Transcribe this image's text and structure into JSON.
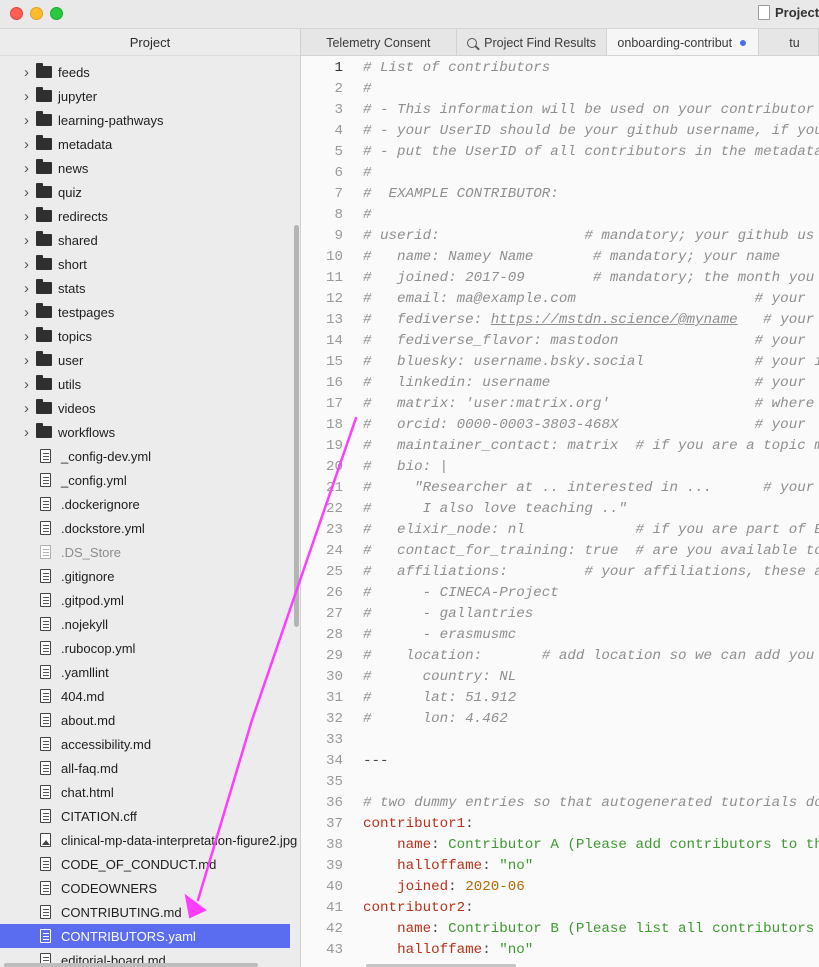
{
  "window": {
    "title": "Project"
  },
  "sidebar": {
    "header": "Project",
    "items": [
      {
        "type": "folder",
        "label": "feeds"
      },
      {
        "type": "folder",
        "label": "jupyter"
      },
      {
        "type": "folder",
        "label": "learning-pathways"
      },
      {
        "type": "folder",
        "label": "metadata"
      },
      {
        "type": "folder",
        "label": "news"
      },
      {
        "type": "folder",
        "label": "quiz"
      },
      {
        "type": "folder",
        "label": "redirects"
      },
      {
        "type": "folder",
        "label": "shared"
      },
      {
        "type": "folder",
        "label": "short"
      },
      {
        "type": "folder",
        "label": "stats"
      },
      {
        "type": "folder",
        "label": "testpages"
      },
      {
        "type": "folder",
        "label": "topics"
      },
      {
        "type": "folder",
        "label": "user"
      },
      {
        "type": "folder",
        "label": "utils"
      },
      {
        "type": "folder",
        "label": "videos"
      },
      {
        "type": "folder",
        "label": "workflows"
      },
      {
        "type": "file",
        "label": "_config-dev.yml"
      },
      {
        "type": "file",
        "label": "_config.yml"
      },
      {
        "type": "file",
        "label": ".dockerignore"
      },
      {
        "type": "file",
        "label": ".dockstore.yml"
      },
      {
        "type": "file",
        "label": ".DS_Store",
        "dim": true
      },
      {
        "type": "file",
        "label": ".gitignore"
      },
      {
        "type": "file",
        "label": ".gitpod.yml"
      },
      {
        "type": "file",
        "label": ".nojekyll"
      },
      {
        "type": "file",
        "label": ".rubocop.yml"
      },
      {
        "type": "file",
        "label": ".yamllint"
      },
      {
        "type": "file",
        "label": "404.md"
      },
      {
        "type": "file",
        "label": "about.md"
      },
      {
        "type": "file",
        "label": "accessibility.md"
      },
      {
        "type": "file",
        "label": "all-faq.md"
      },
      {
        "type": "file",
        "label": "chat.html"
      },
      {
        "type": "file",
        "label": "CITATION.cff"
      },
      {
        "type": "image",
        "label": "clinical-mp-data-interpretation-figure2.jpg"
      },
      {
        "type": "file",
        "label": "CODE_OF_CONDUCT.md"
      },
      {
        "type": "file",
        "label": "CODEOWNERS"
      },
      {
        "type": "file",
        "label": "CONTRIBUTING.md"
      },
      {
        "type": "file",
        "label": "CONTRIBUTORS.yaml",
        "selected": true
      },
      {
        "type": "file",
        "label": "editorial-board.md"
      }
    ]
  },
  "tabs": [
    {
      "label": "Telemetry Consent"
    },
    {
      "label": "Project Find Results",
      "icon": "search-icon"
    },
    {
      "label": "onboarding-contribut",
      "modified": true,
      "active": true
    },
    {
      "label": "tu"
    }
  ],
  "editor": {
    "lines": [
      {
        "n": "1",
        "parts": [
          {
            "c": "cm",
            "t": "# List of contributors"
          }
        ]
      },
      {
        "n": "2",
        "parts": [
          {
            "c": "cm",
            "t": "#"
          }
        ]
      },
      {
        "n": "3",
        "parts": [
          {
            "c": "cm",
            "t": "# - This information will be used on your contributor p"
          }
        ]
      },
      {
        "n": "4",
        "parts": [
          {
            "c": "cm",
            "t": "# - your UserID should be your github username, if you"
          }
        ]
      },
      {
        "n": "5",
        "parts": [
          {
            "c": "cm",
            "t": "# - put the UserID of all contributors in the metadata"
          }
        ]
      },
      {
        "n": "6",
        "parts": [
          {
            "c": "cm",
            "t": "#"
          }
        ]
      },
      {
        "n": "7",
        "parts": [
          {
            "c": "cm",
            "t": "#  EXAMPLE CONTRIBUTOR:"
          }
        ]
      },
      {
        "n": "8",
        "parts": [
          {
            "c": "cm",
            "t": "#"
          }
        ]
      },
      {
        "n": "9",
        "parts": [
          {
            "c": "cm",
            "t": "# userid:                 # mandatory; your github us"
          }
        ]
      },
      {
        "n": "10",
        "parts": [
          {
            "c": "cm",
            "t": "#   name: Namey Name       # mandatory; your name"
          }
        ]
      },
      {
        "n": "11",
        "parts": [
          {
            "c": "cm",
            "t": "#   joined: 2017-09        # mandatory; the month you j"
          }
        ]
      },
      {
        "n": "12",
        "parts": [
          {
            "c": "cm",
            "t": "#   email: ma@example.com                     # your"
          }
        ]
      },
      {
        "n": "13",
        "parts": [
          {
            "c": "cm",
            "t": "#   fediverse: "
          },
          {
            "c": "cm cm-u",
            "t": "https://mstdn.science/@myname"
          },
          {
            "c": "cm",
            "t": "   # your"
          }
        ]
      },
      {
        "n": "14",
        "parts": [
          {
            "c": "cm",
            "t": "#   fediverse_flavor: mastodon                # your"
          }
        ]
      },
      {
        "n": "15",
        "parts": [
          {
            "c": "cm",
            "t": "#   bluesky: username.bsky.social             # your i"
          }
        ]
      },
      {
        "n": "16",
        "parts": [
          {
            "c": "cm",
            "t": "#   linkedin: username                        # your"
          }
        ]
      },
      {
        "n": "17",
        "parts": [
          {
            "c": "cm",
            "t": "#   matrix: 'user:matrix.org'                 # where"
          }
        ]
      },
      {
        "n": "18",
        "parts": [
          {
            "c": "cm",
            "t": "#   orcid: 0000-0003-3803-468X                # your"
          }
        ]
      },
      {
        "n": "19",
        "parts": [
          {
            "c": "cm",
            "t": "#   maintainer_contact: matrix  # if you are a topic m"
          }
        ]
      },
      {
        "n": "20",
        "parts": [
          {
            "c": "cm",
            "t": "#   bio: |"
          }
        ]
      },
      {
        "n": "21",
        "parts": [
          {
            "c": "cm",
            "t": "#     \"Researcher at .. interested in ...      # your"
          }
        ]
      },
      {
        "n": "22",
        "parts": [
          {
            "c": "cm",
            "t": "#      I also love teaching ..\""
          }
        ]
      },
      {
        "n": "23",
        "parts": [
          {
            "c": "cm",
            "t": "#   elixir_node: nl             # if you are part of E"
          }
        ]
      },
      {
        "n": "24",
        "parts": [
          {
            "c": "cm",
            "t": "#   contact_for_training: true  # are you available to"
          }
        ]
      },
      {
        "n": "25",
        "parts": [
          {
            "c": "cm",
            "t": "#   affiliations:         # your affiliations, these a"
          }
        ]
      },
      {
        "n": "26",
        "parts": [
          {
            "c": "cm",
            "t": "#      - CINECA-Project"
          }
        ]
      },
      {
        "n": "27",
        "parts": [
          {
            "c": "cm",
            "t": "#      - gallantries"
          }
        ]
      },
      {
        "n": "28",
        "parts": [
          {
            "c": "cm",
            "t": "#      - erasmusmc"
          }
        ]
      },
      {
        "n": "29",
        "parts": [
          {
            "c": "cm",
            "t": "#    location:       # add location so we can add you"
          }
        ]
      },
      {
        "n": "30",
        "parts": [
          {
            "c": "cm",
            "t": "#      country: NL"
          }
        ]
      },
      {
        "n": "31",
        "parts": [
          {
            "c": "cm",
            "t": "#      lat: 51.912"
          }
        ]
      },
      {
        "n": "32",
        "parts": [
          {
            "c": "cm",
            "t": "#      lon: 4.462"
          }
        ]
      },
      {
        "n": "33",
        "parts": []
      },
      {
        "n": "34",
        "parts": [
          {
            "c": "plain",
            "t": "---"
          }
        ]
      },
      {
        "n": "35",
        "parts": []
      },
      {
        "n": "36",
        "parts": [
          {
            "c": "cm",
            "t": "# two dummy entries so that autogenerated tutorials do"
          }
        ]
      },
      {
        "n": "37",
        "parts": [
          {
            "c": "key",
            "t": "contributor1"
          },
          {
            "c": "plain",
            "t": ":"
          }
        ]
      },
      {
        "n": "38",
        "parts": [
          {
            "c": "plain",
            "t": "    "
          },
          {
            "c": "key",
            "t": "name"
          },
          {
            "c": "plain",
            "t": ": "
          },
          {
            "c": "str",
            "t": "Contributor A (Please add contributors to th"
          }
        ]
      },
      {
        "n": "39",
        "parts": [
          {
            "c": "plain",
            "t": "    "
          },
          {
            "c": "key",
            "t": "halloffame"
          },
          {
            "c": "plain",
            "t": ": "
          },
          {
            "c": "str",
            "t": "\"no\""
          }
        ]
      },
      {
        "n": "40",
        "parts": [
          {
            "c": "plain",
            "t": "    "
          },
          {
            "c": "key",
            "t": "joined"
          },
          {
            "c": "plain",
            "t": ": "
          },
          {
            "c": "num",
            "t": "2020-06"
          }
        ]
      },
      {
        "n": "41",
        "parts": [
          {
            "c": "key",
            "t": "contributor2"
          },
          {
            "c": "plain",
            "t": ":"
          }
        ]
      },
      {
        "n": "42",
        "parts": [
          {
            "c": "plain",
            "t": "    "
          },
          {
            "c": "key",
            "t": "name"
          },
          {
            "c": "plain",
            "t": ": "
          },
          {
            "c": "str",
            "t": "Contributor B (Please list all contributors"
          }
        ]
      },
      {
        "n": "43",
        "parts": [
          {
            "c": "plain",
            "t": "    "
          },
          {
            "c": "key",
            "t": "halloffame"
          },
          {
            "c": "plain",
            "t": ": "
          },
          {
            "c": "str",
            "t": "\"no\""
          }
        ]
      }
    ]
  },
  "colors": {
    "selection": "#5a6cf0",
    "annotation_arrow": "#ff3dff",
    "yaml_key": "#b8321a",
    "yaml_string": "#3d9a2f",
    "comment": "#8f8f8f"
  }
}
